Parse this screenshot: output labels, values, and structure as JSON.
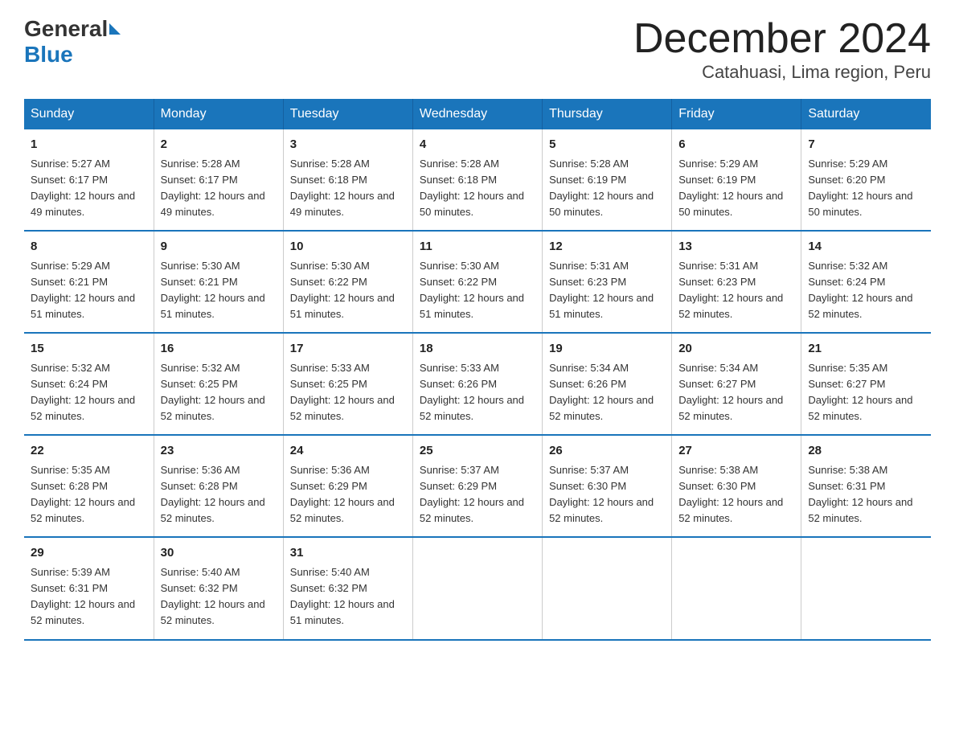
{
  "logo": {
    "general": "General",
    "blue": "Blue"
  },
  "title": "December 2024",
  "subtitle": "Catahuasi, Lima region, Peru",
  "headers": [
    "Sunday",
    "Monday",
    "Tuesday",
    "Wednesday",
    "Thursday",
    "Friday",
    "Saturday"
  ],
  "weeks": [
    [
      {
        "day": "1",
        "sunrise": "5:27 AM",
        "sunset": "6:17 PM",
        "daylight": "12 hours and 49 minutes."
      },
      {
        "day": "2",
        "sunrise": "5:28 AM",
        "sunset": "6:17 PM",
        "daylight": "12 hours and 49 minutes."
      },
      {
        "day": "3",
        "sunrise": "5:28 AM",
        "sunset": "6:18 PM",
        "daylight": "12 hours and 49 minutes."
      },
      {
        "day": "4",
        "sunrise": "5:28 AM",
        "sunset": "6:18 PM",
        "daylight": "12 hours and 50 minutes."
      },
      {
        "day": "5",
        "sunrise": "5:28 AM",
        "sunset": "6:19 PM",
        "daylight": "12 hours and 50 minutes."
      },
      {
        "day": "6",
        "sunrise": "5:29 AM",
        "sunset": "6:19 PM",
        "daylight": "12 hours and 50 minutes."
      },
      {
        "day": "7",
        "sunrise": "5:29 AM",
        "sunset": "6:20 PM",
        "daylight": "12 hours and 50 minutes."
      }
    ],
    [
      {
        "day": "8",
        "sunrise": "5:29 AM",
        "sunset": "6:21 PM",
        "daylight": "12 hours and 51 minutes."
      },
      {
        "day": "9",
        "sunrise": "5:30 AM",
        "sunset": "6:21 PM",
        "daylight": "12 hours and 51 minutes."
      },
      {
        "day": "10",
        "sunrise": "5:30 AM",
        "sunset": "6:22 PM",
        "daylight": "12 hours and 51 minutes."
      },
      {
        "day": "11",
        "sunrise": "5:30 AM",
        "sunset": "6:22 PM",
        "daylight": "12 hours and 51 minutes."
      },
      {
        "day": "12",
        "sunrise": "5:31 AM",
        "sunset": "6:23 PM",
        "daylight": "12 hours and 51 minutes."
      },
      {
        "day": "13",
        "sunrise": "5:31 AM",
        "sunset": "6:23 PM",
        "daylight": "12 hours and 52 minutes."
      },
      {
        "day": "14",
        "sunrise": "5:32 AM",
        "sunset": "6:24 PM",
        "daylight": "12 hours and 52 minutes."
      }
    ],
    [
      {
        "day": "15",
        "sunrise": "5:32 AM",
        "sunset": "6:24 PM",
        "daylight": "12 hours and 52 minutes."
      },
      {
        "day": "16",
        "sunrise": "5:32 AM",
        "sunset": "6:25 PM",
        "daylight": "12 hours and 52 minutes."
      },
      {
        "day": "17",
        "sunrise": "5:33 AM",
        "sunset": "6:25 PM",
        "daylight": "12 hours and 52 minutes."
      },
      {
        "day": "18",
        "sunrise": "5:33 AM",
        "sunset": "6:26 PM",
        "daylight": "12 hours and 52 minutes."
      },
      {
        "day": "19",
        "sunrise": "5:34 AM",
        "sunset": "6:26 PM",
        "daylight": "12 hours and 52 minutes."
      },
      {
        "day": "20",
        "sunrise": "5:34 AM",
        "sunset": "6:27 PM",
        "daylight": "12 hours and 52 minutes."
      },
      {
        "day": "21",
        "sunrise": "5:35 AM",
        "sunset": "6:27 PM",
        "daylight": "12 hours and 52 minutes."
      }
    ],
    [
      {
        "day": "22",
        "sunrise": "5:35 AM",
        "sunset": "6:28 PM",
        "daylight": "12 hours and 52 minutes."
      },
      {
        "day": "23",
        "sunrise": "5:36 AM",
        "sunset": "6:28 PM",
        "daylight": "12 hours and 52 minutes."
      },
      {
        "day": "24",
        "sunrise": "5:36 AM",
        "sunset": "6:29 PM",
        "daylight": "12 hours and 52 minutes."
      },
      {
        "day": "25",
        "sunrise": "5:37 AM",
        "sunset": "6:29 PM",
        "daylight": "12 hours and 52 minutes."
      },
      {
        "day": "26",
        "sunrise": "5:37 AM",
        "sunset": "6:30 PM",
        "daylight": "12 hours and 52 minutes."
      },
      {
        "day": "27",
        "sunrise": "5:38 AM",
        "sunset": "6:30 PM",
        "daylight": "12 hours and 52 minutes."
      },
      {
        "day": "28",
        "sunrise": "5:38 AM",
        "sunset": "6:31 PM",
        "daylight": "12 hours and 52 minutes."
      }
    ],
    [
      {
        "day": "29",
        "sunrise": "5:39 AM",
        "sunset": "6:31 PM",
        "daylight": "12 hours and 52 minutes."
      },
      {
        "day": "30",
        "sunrise": "5:40 AM",
        "sunset": "6:32 PM",
        "daylight": "12 hours and 52 minutes."
      },
      {
        "day": "31",
        "sunrise": "5:40 AM",
        "sunset": "6:32 PM",
        "daylight": "12 hours and 51 minutes."
      },
      {
        "day": "",
        "sunrise": "",
        "sunset": "",
        "daylight": ""
      },
      {
        "day": "",
        "sunrise": "",
        "sunset": "",
        "daylight": ""
      },
      {
        "day": "",
        "sunrise": "",
        "sunset": "",
        "daylight": ""
      },
      {
        "day": "",
        "sunrise": "",
        "sunset": "",
        "daylight": ""
      }
    ]
  ],
  "labels": {
    "sunrise_prefix": "Sunrise: ",
    "sunset_prefix": "Sunset: ",
    "daylight_prefix": "Daylight: "
  }
}
